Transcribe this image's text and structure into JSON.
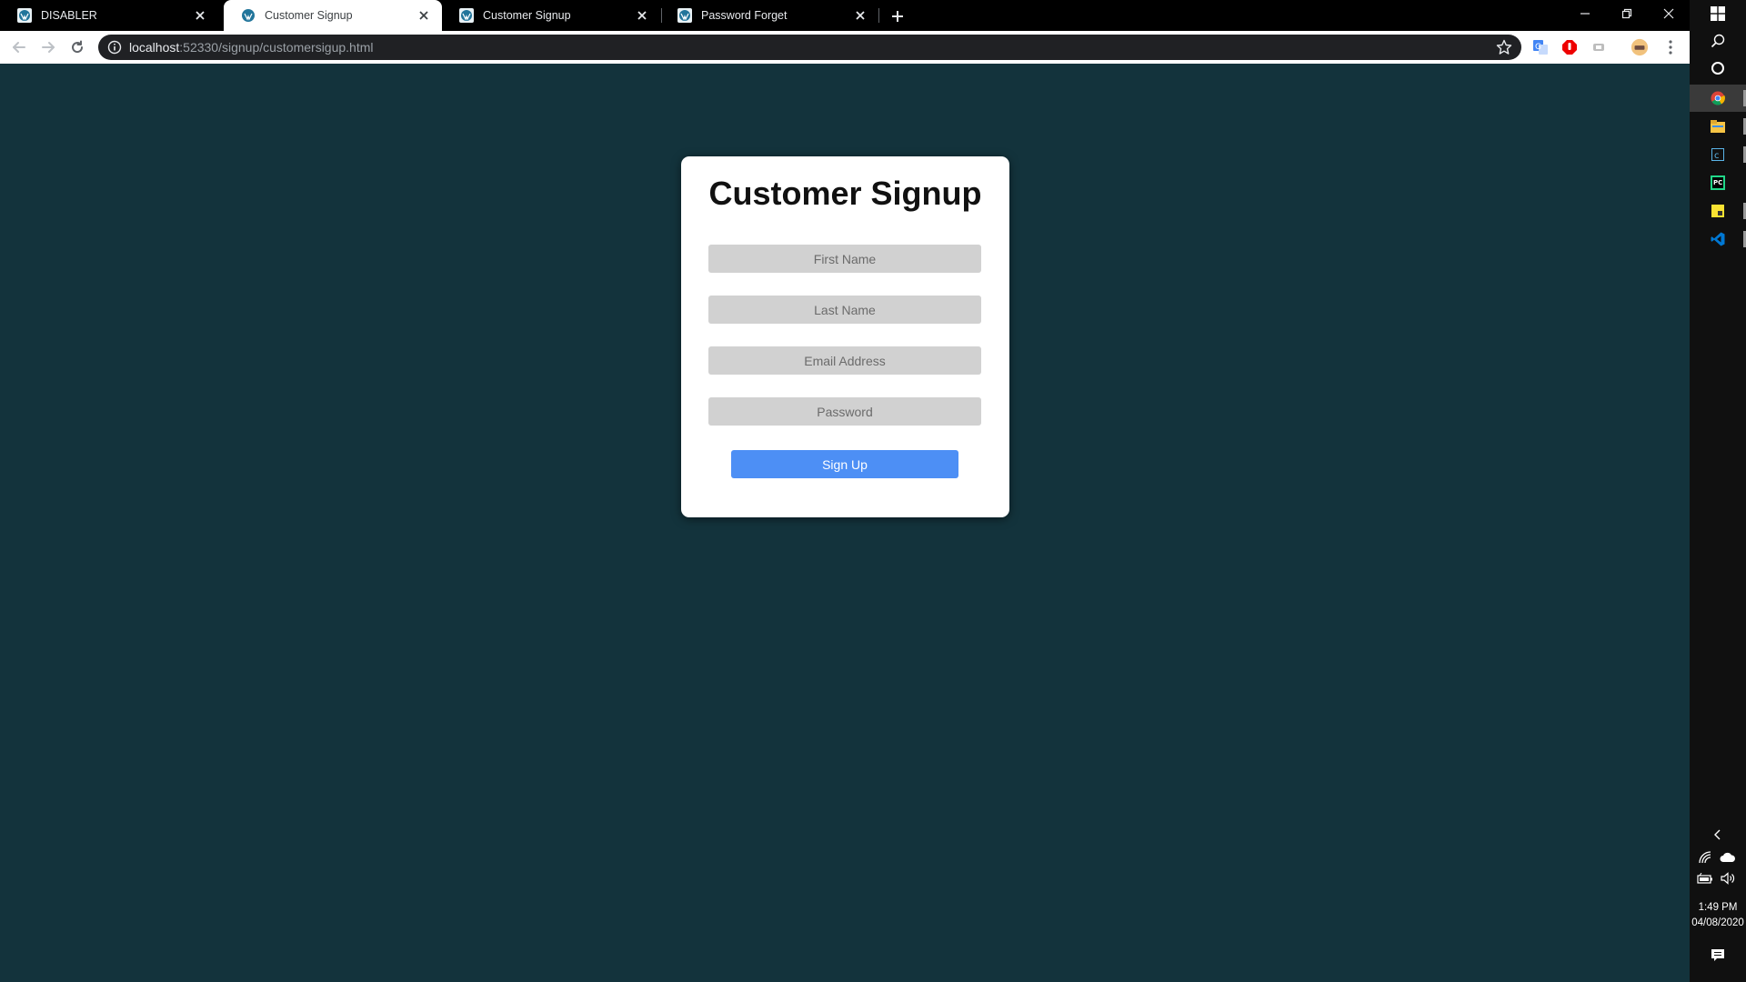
{
  "browser": {
    "tabs": [
      {
        "title": "DISABLER",
        "active": false
      },
      {
        "title": "Customer Signup",
        "active": true
      },
      {
        "title": "Customer Signup",
        "active": false
      },
      {
        "title": "Password Forget",
        "active": false
      }
    ],
    "address_bar": {
      "host": "localhost",
      "rest": ":52330/signup/customersigup.html"
    },
    "icons": {
      "back": "arrow-left-icon",
      "forward": "arrow-right-icon",
      "reload": "reload-icon",
      "info": "info-icon",
      "bookmark": "star-icon",
      "menu": "kebab-menu-icon"
    }
  },
  "page": {
    "background_color": "#13333c",
    "card": {
      "title": "Customer Signup",
      "fields": {
        "first_name": {
          "placeholder": "First Name",
          "value": ""
        },
        "last_name": {
          "placeholder": "Last Name",
          "value": ""
        },
        "email": {
          "placeholder": "Email Address",
          "value": ""
        },
        "password": {
          "placeholder": "Password",
          "value": ""
        }
      },
      "submit_label": "Sign Up",
      "accent_color": "#4d8ff5"
    }
  },
  "taskbar": {
    "clock": {
      "time": "1:49 PM",
      "date": "04/08/2020"
    },
    "apps": [
      "windows-start-icon",
      "search-icon",
      "cortana-icon",
      "chrome-icon",
      "file-explorer-icon",
      "calculator-icon",
      "pycharm-icon",
      "sticky-notes-icon",
      "vscode-icon"
    ]
  }
}
